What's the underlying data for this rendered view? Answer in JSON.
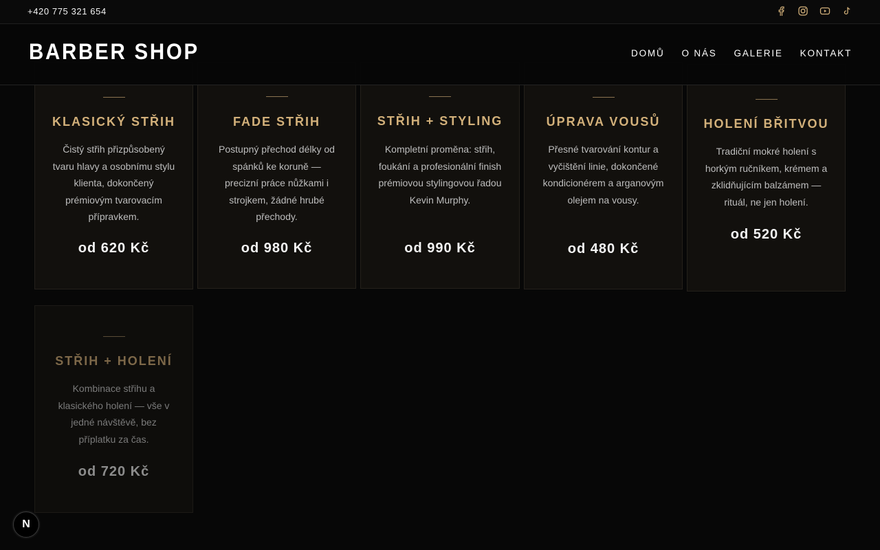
{
  "topbar": {
    "phone": "+420 775 321 654",
    "socials": [
      "facebook-icon",
      "instagram-icon",
      "youtube-icon",
      "tiktok-icon"
    ],
    "icon_color": "#d2b07a"
  },
  "header": {
    "logo": "BARBER SHOP",
    "nav": [
      "DOMŮ",
      "O NÁS",
      "GALERIE",
      "KONTAKT"
    ]
  },
  "services": [
    {
      "title": "KLASICKÝ STŘIH",
      "description": "Čistý střih přizpůsobený tvaru hlavy a osobnímu stylu klienta, dokončený prémiovým tvarovacím přípravkem.",
      "price": "od 620 Kč"
    },
    {
      "title": "FADE STŘIH",
      "description": "Postupný přechod délky od spánků ke koruně — precizní práce nůžkami i strojkem, žádné hrubé přechody.",
      "price": "od 980 Kč"
    },
    {
      "title": "STŘIH + STYLING",
      "description": "Kompletní proměna: střih, foukání a profesionální finish prémiovou stylingovou řadou Kevin Murphy.",
      "price": "od 990 Kč"
    },
    {
      "title": "ÚPRAVA VOUSŮ",
      "description": "Přesné tvarování kontur a vyčištění linie, dokončené kondicionérem a arganovým olejem na vousy.",
      "price": "od 480 Kč"
    },
    {
      "title": "HOLENÍ BŘITVOU",
      "description": "Tradiční mokré holení s horkým ručníkem, krémem a zklidňujícím balzámem — rituál, ne jen holení.",
      "price": "od 520 Kč"
    },
    {
      "title": "STŘIH + HOLENÍ",
      "description": "Kombinace střihu a klasického holení — vše v jedné návštěvě, bez příplatku za čas.",
      "price": "od 720 Kč"
    }
  ],
  "floating_badge": "N",
  "colors": {
    "accent": "#d2b07a",
    "background": "#070707"
  }
}
